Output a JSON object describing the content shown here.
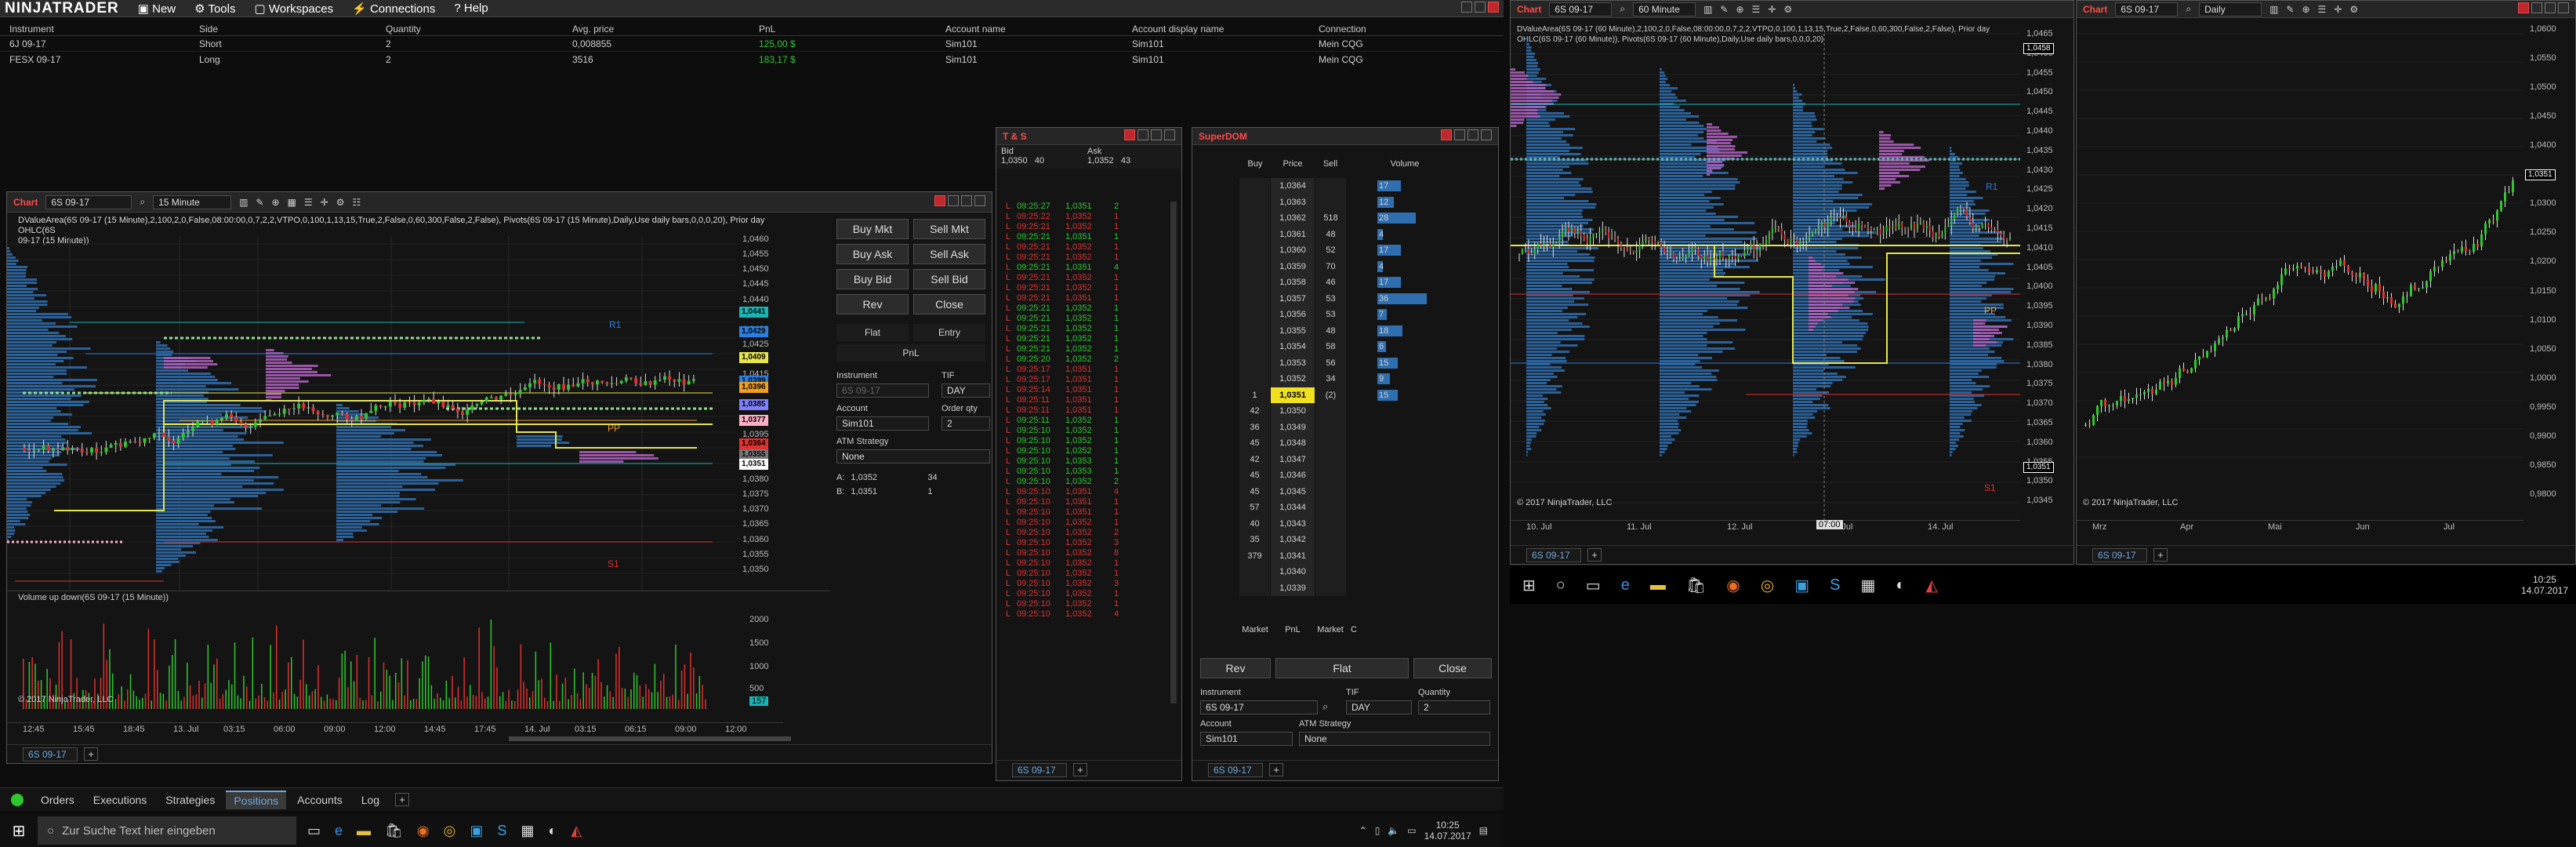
{
  "app": {
    "logo": "NINJATRADER",
    "menu": [
      "New",
      "Tools",
      "Workspaces",
      "Connections",
      "Help"
    ]
  },
  "positions": {
    "columns": [
      "Instrument",
      "Side",
      "Quantity",
      "Avg. price",
      "PnL",
      "Account name",
      "Account display name",
      "Connection"
    ],
    "rows": [
      {
        "instrument": "6J 09-17",
        "side": "Short",
        "qty": "2",
        "avg": "0,008855",
        "pnl": "125,00 $",
        "acc": "Sim101",
        "disp": "Sim101",
        "conn": "Mein CQG"
      },
      {
        "instrument": "FESX 09-17",
        "side": "Long",
        "qty": "2",
        "avg": "3516",
        "pnl": "183,17 $",
        "acc": "Sim101",
        "disp": "Sim101",
        "conn": "Mein CQG"
      }
    ]
  },
  "chart1": {
    "title": "Chart",
    "instrument": "6S 09-17",
    "interval": "15 Minute",
    "info": "DValueArea(6S 09-17 (15 Minute),2,100,2,0,False,08:00:00,0,7,2,2,VTPO,0,100,1,13,15,True,2,False,0,60,300,False,2,False), Pivots(6S 09-17 (15 Minute),Daily,Use daily bars,0,0,0,20), Prior day OHLC(6S",
    "info2": "09-17 (15 Minute))",
    "yaxis": [
      "1,0460",
      "1,0455",
      "1,0450",
      "1,0445",
      "1,0440",
      "1,0435",
      "1,0430",
      "1,0425",
      "1,0420",
      "1,0415",
      "1,0410",
      "1,0405",
      "1,0400",
      "1,0395",
      "1,0390",
      "1,0385",
      "1,0380",
      "1,0375",
      "1,0370",
      "1,0365",
      "1,0360",
      "1,0355",
      "1,0350"
    ],
    "tags": [
      {
        "label": "1,0441",
        "color": "#19b5b5"
      },
      {
        "label": "1,0429",
        "color": "#2a7fe0"
      },
      {
        "label": "1,0409",
        "color": "#e6e64a"
      },
      {
        "label": "1,0399",
        "color": "#2a7fe0"
      },
      {
        "label": "1,0396",
        "color": "#f0a020"
      },
      {
        "label": "1,0385",
        "color": "#8080ff"
      },
      {
        "label": "1,0377",
        "color": "#ffb0c8"
      },
      {
        "label": "1,0364",
        "color": "#e03030"
      },
      {
        "label": "1,0355",
        "color": "#777777"
      },
      {
        "label": "1,0351",
        "color": "#ffffff"
      }
    ],
    "labels": {
      "r1": "R1",
      "pp": "PP",
      "s1": "S1"
    },
    "volTitle": "Volume up down(6S 09-17 (15 Minute))",
    "volAxis": [
      "2000",
      "1500",
      "1000",
      "500",
      "157"
    ],
    "copyright": "© 2017 NinjaTrader, LLC",
    "xaxis": [
      "12:45",
      "15:45",
      "18:45",
      "13. Jul",
      "03:15",
      "06:00",
      "09:00",
      "12:00",
      "14:45",
      "17:45",
      "14. Jul",
      "03:15",
      "06:15",
      "09:00",
      "12:00"
    ],
    "tab": "6S 09-17"
  },
  "chartTrader": {
    "buyMkt": "Buy Mkt",
    "sellMkt": "Sell Mkt",
    "buyAsk": "Buy Ask",
    "sellAsk": "Sell Ask",
    "buyBid": "Buy Bid",
    "sellBid": "Sell Bid",
    "rev": "Rev",
    "close": "Close",
    "flat": "Flat",
    "entry": "Entry",
    "pnl": "PnL",
    "instrumentLbl": "Instrument",
    "tifLbl": "TIF",
    "instrument": "6S 09-17",
    "tif": "DAY",
    "accountLbl": "Account",
    "qtyLbl": "Order qty",
    "account": "Sim101",
    "qty": "2",
    "atmLbl": "ATM Strategy",
    "atm": "None",
    "aLbl": "A:",
    "aPrice": "1,0352",
    "aSize": "34",
    "bLbl": "B:",
    "bPrice": "1,0351",
    "bSize": "1"
  },
  "ts": {
    "title": "T & S",
    "bidLbl": "Bid",
    "askLbl": "Ask",
    "bid": "1,0350",
    "bidSize": "40",
    "ask": "1,0352",
    "askSize": "43",
    "rows": [
      [
        "L",
        "09:25:27",
        "1,0351",
        "2",
        "g"
      ],
      [
        "L",
        "09:25:22",
        "1,0352",
        "1",
        "r"
      ],
      [
        "L",
        "09:25:21",
        "1,0352",
        "1",
        "r"
      ],
      [
        "L",
        "09:25:21",
        "1,0351",
        "1",
        "g"
      ],
      [
        "L",
        "09:25:21",
        "1,0352",
        "1",
        "r"
      ],
      [
        "L",
        "09:25:21",
        "1,0352",
        "1",
        "r"
      ],
      [
        "L",
        "09:25:21",
        "1,0351",
        "4",
        "g"
      ],
      [
        "L",
        "09:25:21",
        "1,0352",
        "1",
        "r"
      ],
      [
        "L",
        "09:25:21",
        "1,0352",
        "1",
        "r"
      ],
      [
        "L",
        "09:25:21",
        "1,0351",
        "1",
        "r"
      ],
      [
        "L",
        "09:25:21",
        "1,0352",
        "1",
        "g"
      ],
      [
        "L",
        "09:25:21",
        "1,0352",
        "1",
        "g"
      ],
      [
        "L",
        "09:25:21",
        "1,0352",
        "1",
        "g"
      ],
      [
        "L",
        "09:25:21",
        "1,0352",
        "1",
        "g"
      ],
      [
        "L",
        "09:25:21",
        "1,0352",
        "1",
        "g"
      ],
      [
        "L",
        "09:25:20",
        "1,0352",
        "2",
        "g"
      ],
      [
        "L",
        "09:25:17",
        "1,0351",
        "1",
        "r"
      ],
      [
        "L",
        "09:25:17",
        "1,0351",
        "1",
        "r"
      ],
      [
        "L",
        "09:25:14",
        "1,0351",
        "1",
        "r"
      ],
      [
        "L",
        "09:25:11",
        "1,0351",
        "1",
        "r"
      ],
      [
        "L",
        "09:25:11",
        "1,0351",
        "1",
        "r"
      ],
      [
        "L",
        "09:25:11",
        "1,0352",
        "1",
        "g"
      ],
      [
        "L",
        "09:25:10",
        "1,0352",
        "1",
        "g"
      ],
      [
        "L",
        "09:25:10",
        "1,0352",
        "1",
        "g"
      ],
      [
        "L",
        "09:25:10",
        "1,0352",
        "1",
        "g"
      ],
      [
        "L",
        "09:25:10",
        "1,0353",
        "1",
        "g"
      ],
      [
        "L",
        "09:25:10",
        "1,0353",
        "1",
        "g"
      ],
      [
        "L",
        "09:25:10",
        "1,0352",
        "2",
        "g"
      ],
      [
        "L",
        "09:25:10",
        "1,0351",
        "4",
        "r"
      ],
      [
        "L",
        "09:25:10",
        "1,0351",
        "1",
        "r"
      ],
      [
        "L",
        "09:25:10",
        "1,0351",
        "1",
        "r"
      ],
      [
        "L",
        "09:25:10",
        "1,0352",
        "1",
        "r"
      ],
      [
        "L",
        "09:25:10",
        "1,0352",
        "2",
        "r"
      ],
      [
        "L",
        "09:25:10",
        "1,0352",
        "3",
        "r"
      ],
      [
        "L",
        "09:25:10",
        "1,0352",
        "8",
        "r"
      ],
      [
        "L",
        "09:25:10",
        "1,0352",
        "1",
        "r"
      ],
      [
        "L",
        "09:25:10",
        "1,0352",
        "1",
        "r"
      ],
      [
        "L",
        "09:25:10",
        "1,0352",
        "3",
        "r"
      ],
      [
        "L",
        "09:25:10",
        "1,0352",
        "1",
        "r"
      ],
      [
        "L",
        "09:25:10",
        "1,0352",
        "1",
        "r"
      ],
      [
        "L",
        "09:25:10",
        "1,0352",
        "4",
        "r"
      ]
    ],
    "tab": "6S 09-17"
  },
  "dom": {
    "title": "SuperDOM",
    "cols": [
      "Buy",
      "Price",
      "Sell",
      "Volume"
    ],
    "rows": [
      {
        "buy": "",
        "price": "1,0364",
        "sell": "",
        "vol": "17"
      },
      {
        "buy": "",
        "price": "1,0363",
        "sell": "",
        "vol": "12"
      },
      {
        "buy": "",
        "price": "1,0362",
        "sell": "518",
        "vol": "28"
      },
      {
        "buy": "",
        "price": "1,0361",
        "sell": "48",
        "vol": "4"
      },
      {
        "buy": "",
        "price": "1,0360",
        "sell": "52",
        "vol": "17"
      },
      {
        "buy": "",
        "price": "1,0359",
        "sell": "70",
        "vol": "4"
      },
      {
        "buy": "",
        "price": "1,0358",
        "sell": "46",
        "vol": "17"
      },
      {
        "buy": "",
        "price": "1,0357",
        "sell": "53",
        "vol": "36"
      },
      {
        "buy": "",
        "price": "1,0356",
        "sell": "53",
        "vol": "7"
      },
      {
        "buy": "",
        "price": "1,0355",
        "sell": "48",
        "vol": "18"
      },
      {
        "buy": "",
        "price": "1,0354",
        "sell": "58",
        "vol": "6"
      },
      {
        "buy": "",
        "price": "1,0353",
        "sell": "56",
        "vol": "15"
      },
      {
        "buy": "",
        "price": "1,0352",
        "sell": "34",
        "vol": "9"
      },
      {
        "buy": "1",
        "price": "1,0351",
        "sell": "(2)",
        "vol": "15"
      },
      {
        "buy": "42",
        "price": "1,0350",
        "sell": "",
        "vol": ""
      },
      {
        "buy": "36",
        "price": "1,0349",
        "sell": "",
        "vol": ""
      },
      {
        "buy": "45",
        "price": "1,0348",
        "sell": "",
        "vol": ""
      },
      {
        "buy": "42",
        "price": "1,0347",
        "sell": "",
        "vol": ""
      },
      {
        "buy": "45",
        "price": "1,0346",
        "sell": "",
        "vol": ""
      },
      {
        "buy": "45",
        "price": "1,0345",
        "sell": "",
        "vol": ""
      },
      {
        "buy": "57",
        "price": "1,0344",
        "sell": "",
        "vol": ""
      },
      {
        "buy": "40",
        "price": "1,0343",
        "sell": "",
        "vol": ""
      },
      {
        "buy": "35",
        "price": "1,0342",
        "sell": "",
        "vol": ""
      },
      {
        "buy": "379",
        "price": "1,0341",
        "sell": "",
        "vol": ""
      },
      {
        "buy": "",
        "price": "1,0340",
        "sell": "",
        "vol": ""
      },
      {
        "buy": "",
        "price": "1,0339",
        "sell": "",
        "vol": ""
      }
    ],
    "footer": {
      "mkt1": "Market",
      "pnl": "PnL",
      "mkt2": "Market",
      "c": "C"
    },
    "rev": "Rev",
    "flat": "Flat",
    "close": "Close",
    "instrumentLbl": "Instrument",
    "tifLbl": "TIF",
    "qtyLbl": "Quantity",
    "instrument": "6S 09-17",
    "tif": "DAY",
    "qty": "2",
    "accountLbl": "Account",
    "atmLbl": "ATM Strategy",
    "account": "Sim101",
    "atm": "None",
    "tab": "6S 09-17"
  },
  "tabs": [
    "Orders",
    "Executions",
    "Strategies",
    "Positions",
    "Accounts",
    "Log"
  ],
  "taskbar": {
    "search": "Zur Suche Text hier eingeben",
    "time": "10:25",
    "date": "14.07.2017"
  },
  "chart2": {
    "title": "Chart",
    "instrument": "6S 09-17",
    "interval": "60 Minute",
    "info": "DValueArea(6S 09-17 (60 Minute),2,100,2,0,False,08:00:00,0,7,2,2,VTPO,0,100,1,13,15,True,2,False,0,60,300,False,2,False), Prior day",
    "info2": "OHLC(6S 09-17 (60 Minute)), Pivots(6S 09-17 (60 Minute),Daily,Use daily bars,0,0,0,20)",
    "yaxis": [
      "1,0465",
      "1,0460",
      "1,0455",
      "1,0450",
      "1,0445",
      "1,0440",
      "1,0435",
      "1,0430",
      "1,0425",
      "1,0420",
      "1,0415",
      "1,0410",
      "1,0405",
      "1,0400",
      "1,0395",
      "1,0390",
      "1,0385",
      "1,0380",
      "1,0375",
      "1,0370",
      "1,0365",
      "1,0360",
      "1,0355",
      "1,0350",
      "1,0345"
    ],
    "tags": [
      {
        "label": "1,0458",
        "color": "#ffffff"
      },
      {
        "label": "1,0351",
        "color": "#ffffff"
      }
    ],
    "labels": {
      "r1": "R1",
      "pp": "PP",
      "s1": "S1"
    },
    "xaxis": [
      "10. Jul",
      "11. Jul",
      "12. Jul",
      "13. Jul",
      "14. Jul"
    ],
    "cursorX": "07:00",
    "copyright": "© 2017 NinjaTrader, LLC",
    "tab": "6S 09-17"
  },
  "chart3": {
    "title": "Chart",
    "instrument": "6S 09-17",
    "interval": "Daily",
    "yaxis": [
      "1,0600",
      "1,0550",
      "1,0500",
      "1,0450",
      "1,0400",
      "1,0351",
      "1,0300",
      "1,0250",
      "1,0200",
      "1,0150",
      "1,0100",
      "1,0050",
      "1,0000",
      "0,9950",
      "0,9900",
      "0,9850",
      "0,9800"
    ],
    "xaxis": [
      "Mrz",
      "Apr",
      "Mai",
      "Jun",
      "Jul"
    ],
    "copyright": "© 2017 NinjaTrader, LLC",
    "tab": "6S 09-17"
  },
  "taskbar2": {
    "time": "10:25",
    "date": "14.07.2017"
  },
  "colors": {
    "accent": "#ff4a4a",
    "up": "#2ec82e",
    "down": "#e03030",
    "poc": "#f0e020",
    "va": "#2f6fb0",
    "tpo": "#b060c0"
  }
}
